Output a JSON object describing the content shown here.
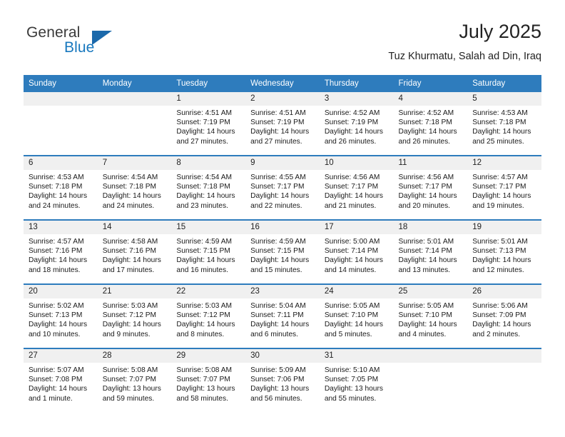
{
  "brand": {
    "name_top": "General",
    "name_bottom": "Blue",
    "accent_color": "#1b69ab",
    "text_color": "#3a3a3a"
  },
  "header": {
    "month_title": "July 2025",
    "location": "Tuz Khurmatu, Salah ad Din, Iraq"
  },
  "theme": {
    "header_bg": "#2e7cbd",
    "daynum_bg": "#f0f0f0",
    "cell_bg": "#ffffff",
    "text": "#1a1a1a"
  },
  "weekday_headers": [
    "Sunday",
    "Monday",
    "Tuesday",
    "Wednesday",
    "Thursday",
    "Friday",
    "Saturday"
  ],
  "weeks": [
    [
      {
        "day": "",
        "empty": true,
        "sunrise": "",
        "sunset": "",
        "daylight_line1": "",
        "daylight_line2": ""
      },
      {
        "day": "",
        "empty": true,
        "sunrise": "",
        "sunset": "",
        "daylight_line1": "",
        "daylight_line2": ""
      },
      {
        "day": "1",
        "sunrise": "Sunrise: 4:51 AM",
        "sunset": "Sunset: 7:19 PM",
        "daylight_line1": "Daylight: 14 hours",
        "daylight_line2": "and 27 minutes."
      },
      {
        "day": "2",
        "sunrise": "Sunrise: 4:51 AM",
        "sunset": "Sunset: 7:19 PM",
        "daylight_line1": "Daylight: 14 hours",
        "daylight_line2": "and 27 minutes."
      },
      {
        "day": "3",
        "sunrise": "Sunrise: 4:52 AM",
        "sunset": "Sunset: 7:19 PM",
        "daylight_line1": "Daylight: 14 hours",
        "daylight_line2": "and 26 minutes."
      },
      {
        "day": "4",
        "sunrise": "Sunrise: 4:52 AM",
        "sunset": "Sunset: 7:18 PM",
        "daylight_line1": "Daylight: 14 hours",
        "daylight_line2": "and 26 minutes."
      },
      {
        "day": "5",
        "sunrise": "Sunrise: 4:53 AM",
        "sunset": "Sunset: 7:18 PM",
        "daylight_line1": "Daylight: 14 hours",
        "daylight_line2": "and 25 minutes."
      }
    ],
    [
      {
        "day": "6",
        "sunrise": "Sunrise: 4:53 AM",
        "sunset": "Sunset: 7:18 PM",
        "daylight_line1": "Daylight: 14 hours",
        "daylight_line2": "and 24 minutes."
      },
      {
        "day": "7",
        "sunrise": "Sunrise: 4:54 AM",
        "sunset": "Sunset: 7:18 PM",
        "daylight_line1": "Daylight: 14 hours",
        "daylight_line2": "and 24 minutes."
      },
      {
        "day": "8",
        "sunrise": "Sunrise: 4:54 AM",
        "sunset": "Sunset: 7:18 PM",
        "daylight_line1": "Daylight: 14 hours",
        "daylight_line2": "and 23 minutes."
      },
      {
        "day": "9",
        "sunrise": "Sunrise: 4:55 AM",
        "sunset": "Sunset: 7:17 PM",
        "daylight_line1": "Daylight: 14 hours",
        "daylight_line2": "and 22 minutes."
      },
      {
        "day": "10",
        "sunrise": "Sunrise: 4:56 AM",
        "sunset": "Sunset: 7:17 PM",
        "daylight_line1": "Daylight: 14 hours",
        "daylight_line2": "and 21 minutes."
      },
      {
        "day": "11",
        "sunrise": "Sunrise: 4:56 AM",
        "sunset": "Sunset: 7:17 PM",
        "daylight_line1": "Daylight: 14 hours",
        "daylight_line2": "and 20 minutes."
      },
      {
        "day": "12",
        "sunrise": "Sunrise: 4:57 AM",
        "sunset": "Sunset: 7:17 PM",
        "daylight_line1": "Daylight: 14 hours",
        "daylight_line2": "and 19 minutes."
      }
    ],
    [
      {
        "day": "13",
        "sunrise": "Sunrise: 4:57 AM",
        "sunset": "Sunset: 7:16 PM",
        "daylight_line1": "Daylight: 14 hours",
        "daylight_line2": "and 18 minutes."
      },
      {
        "day": "14",
        "sunrise": "Sunrise: 4:58 AM",
        "sunset": "Sunset: 7:16 PM",
        "daylight_line1": "Daylight: 14 hours",
        "daylight_line2": "and 17 minutes."
      },
      {
        "day": "15",
        "sunrise": "Sunrise: 4:59 AM",
        "sunset": "Sunset: 7:15 PM",
        "daylight_line1": "Daylight: 14 hours",
        "daylight_line2": "and 16 minutes."
      },
      {
        "day": "16",
        "sunrise": "Sunrise: 4:59 AM",
        "sunset": "Sunset: 7:15 PM",
        "daylight_line1": "Daylight: 14 hours",
        "daylight_line2": "and 15 minutes."
      },
      {
        "day": "17",
        "sunrise": "Sunrise: 5:00 AM",
        "sunset": "Sunset: 7:14 PM",
        "daylight_line1": "Daylight: 14 hours",
        "daylight_line2": "and 14 minutes."
      },
      {
        "day": "18",
        "sunrise": "Sunrise: 5:01 AM",
        "sunset": "Sunset: 7:14 PM",
        "daylight_line1": "Daylight: 14 hours",
        "daylight_line2": "and 13 minutes."
      },
      {
        "day": "19",
        "sunrise": "Sunrise: 5:01 AM",
        "sunset": "Sunset: 7:13 PM",
        "daylight_line1": "Daylight: 14 hours",
        "daylight_line2": "and 12 minutes."
      }
    ],
    [
      {
        "day": "20",
        "sunrise": "Sunrise: 5:02 AM",
        "sunset": "Sunset: 7:13 PM",
        "daylight_line1": "Daylight: 14 hours",
        "daylight_line2": "and 10 minutes."
      },
      {
        "day": "21",
        "sunrise": "Sunrise: 5:03 AM",
        "sunset": "Sunset: 7:12 PM",
        "daylight_line1": "Daylight: 14 hours",
        "daylight_line2": "and 9 minutes."
      },
      {
        "day": "22",
        "sunrise": "Sunrise: 5:03 AM",
        "sunset": "Sunset: 7:12 PM",
        "daylight_line1": "Daylight: 14 hours",
        "daylight_line2": "and 8 minutes."
      },
      {
        "day": "23",
        "sunrise": "Sunrise: 5:04 AM",
        "sunset": "Sunset: 7:11 PM",
        "daylight_line1": "Daylight: 14 hours",
        "daylight_line2": "and 6 minutes."
      },
      {
        "day": "24",
        "sunrise": "Sunrise: 5:05 AM",
        "sunset": "Sunset: 7:10 PM",
        "daylight_line1": "Daylight: 14 hours",
        "daylight_line2": "and 5 minutes."
      },
      {
        "day": "25",
        "sunrise": "Sunrise: 5:05 AM",
        "sunset": "Sunset: 7:10 PM",
        "daylight_line1": "Daylight: 14 hours",
        "daylight_line2": "and 4 minutes."
      },
      {
        "day": "26",
        "sunrise": "Sunrise: 5:06 AM",
        "sunset": "Sunset: 7:09 PM",
        "daylight_line1": "Daylight: 14 hours",
        "daylight_line2": "and 2 minutes."
      }
    ],
    [
      {
        "day": "27",
        "sunrise": "Sunrise: 5:07 AM",
        "sunset": "Sunset: 7:08 PM",
        "daylight_line1": "Daylight: 14 hours",
        "daylight_line2": "and 1 minute."
      },
      {
        "day": "28",
        "sunrise": "Sunrise: 5:08 AM",
        "sunset": "Sunset: 7:07 PM",
        "daylight_line1": "Daylight: 13 hours",
        "daylight_line2": "and 59 minutes."
      },
      {
        "day": "29",
        "sunrise": "Sunrise: 5:08 AM",
        "sunset": "Sunset: 7:07 PM",
        "daylight_line1": "Daylight: 13 hours",
        "daylight_line2": "and 58 minutes."
      },
      {
        "day": "30",
        "sunrise": "Sunrise: 5:09 AM",
        "sunset": "Sunset: 7:06 PM",
        "daylight_line1": "Daylight: 13 hours",
        "daylight_line2": "and 56 minutes."
      },
      {
        "day": "31",
        "sunrise": "Sunrise: 5:10 AM",
        "sunset": "Sunset: 7:05 PM",
        "daylight_line1": "Daylight: 13 hours",
        "daylight_line2": "and 55 minutes."
      },
      {
        "day": "",
        "empty": true,
        "sunrise": "",
        "sunset": "",
        "daylight_line1": "",
        "daylight_line2": ""
      },
      {
        "day": "",
        "empty": true,
        "sunrise": "",
        "sunset": "",
        "daylight_line1": "",
        "daylight_line2": ""
      }
    ]
  ]
}
